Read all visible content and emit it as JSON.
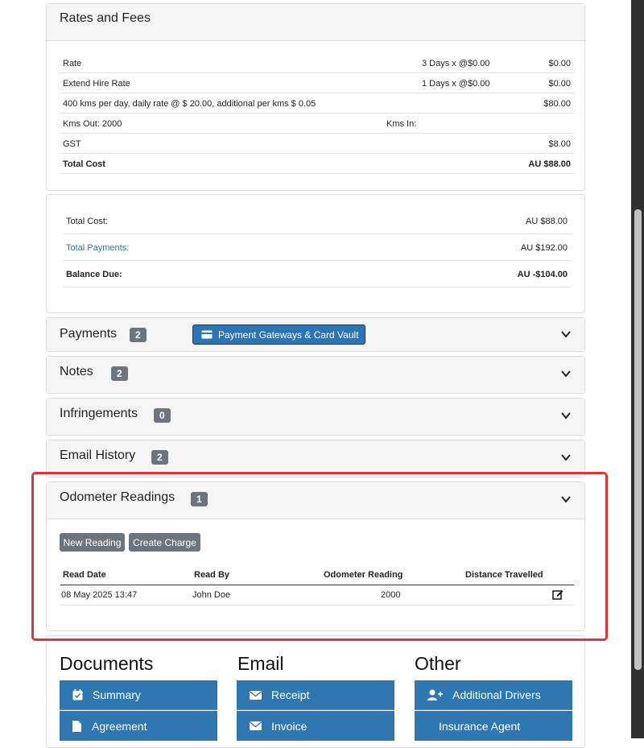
{
  "rates": {
    "title": "Rates and Fees",
    "rows": [
      {
        "label": "Rate",
        "middle": "3 Days x @$0.00",
        "amount": "$0.00"
      },
      {
        "label": "Extend Hire Rate",
        "middle": "1 Days x @$0.00",
        "amount": "$0.00"
      },
      {
        "label": "400 kms per day, daily rate @ $ 20.00, additional per kms $ 0.05",
        "middle": "",
        "amount": "$80.00"
      },
      {
        "label": "Kms Out: 2000",
        "middle": "Kms In:",
        "amount": ""
      },
      {
        "label": "GST",
        "middle": "",
        "amount": "$8.00"
      },
      {
        "label": "Total Cost",
        "middle": "",
        "amount": "AU $88.00"
      }
    ]
  },
  "totals": {
    "total_cost_label": "Total Cost:",
    "total_cost_value": "AU $88.00",
    "total_payments_label": "Total Payments:",
    "total_payments_value": "AU $192.00",
    "balance_label": "Balance Due:",
    "balance_value": "AU -$104.00"
  },
  "sections": {
    "payments": {
      "title": "Payments",
      "count": "2",
      "gateway_button": "Payment Gateways & Card Vault"
    },
    "notes": {
      "title": "Notes",
      "count": "2"
    },
    "infringements": {
      "title": "Infringements",
      "count": "0"
    },
    "email_history": {
      "title": "Email History",
      "count": "2"
    },
    "odometer": {
      "title": "Odometer Readings",
      "count": "1",
      "new_reading": "New Reading",
      "create_charge": "Create Charge",
      "headers": [
        "Read Date",
        "Read By",
        "Odometer Reading",
        "Distance Travelled"
      ],
      "rows": [
        {
          "date": "08 May 2025 13:47",
          "by": "John Doe",
          "reading": "2000",
          "distance": ""
        }
      ]
    }
  },
  "documents": {
    "title": "Documents",
    "items": [
      "Summary",
      "Agreement"
    ]
  },
  "email": {
    "title": "Email",
    "items": [
      "Receipt",
      "Invoice"
    ]
  },
  "other": {
    "title": "Other",
    "items": [
      "Additional Drivers",
      "Insurance Agent"
    ]
  },
  "colors": {
    "primary": "#2c74b3",
    "badge": "#6c757d",
    "highlight": "#d9363e"
  }
}
